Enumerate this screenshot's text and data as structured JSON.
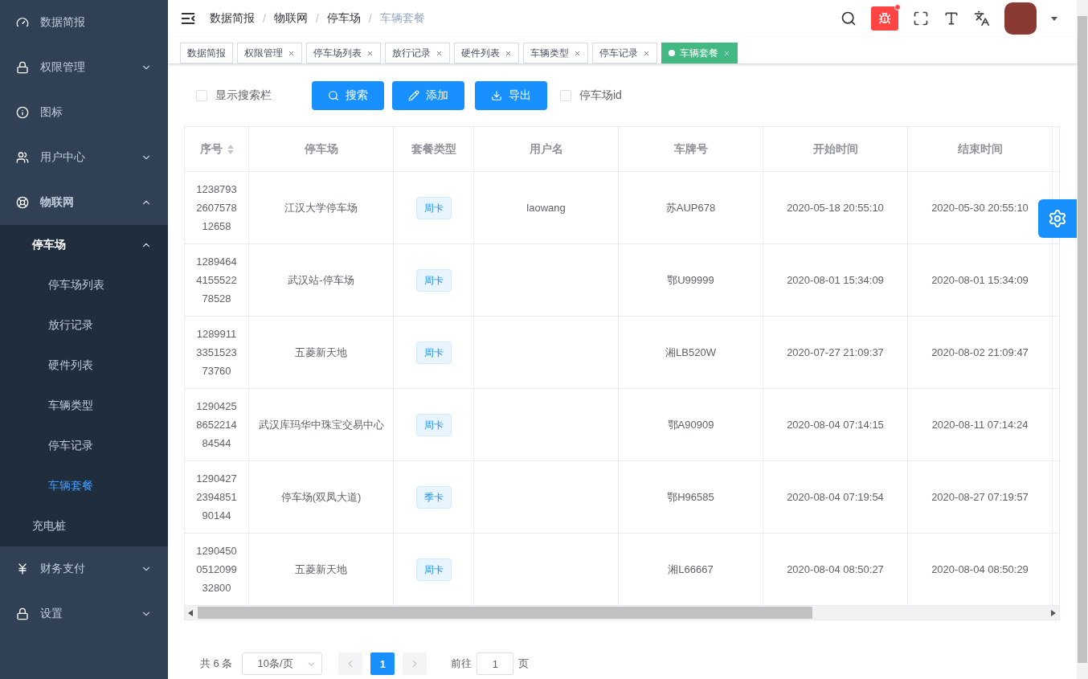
{
  "sidebar": {
    "items": [
      {
        "label": "数据简报",
        "selected": false
      },
      {
        "label": "权限管理",
        "expanded": false,
        "selected": false
      },
      {
        "label": "图标",
        "selected": false
      },
      {
        "label": "用户中心",
        "expanded": false,
        "selected": false
      },
      {
        "label": "物联网",
        "expanded": true,
        "selected": false,
        "children": [
          {
            "label": "停车场",
            "expanded": true,
            "selected": false,
            "children": [
              {
                "label": "停车场列表",
                "selected": false
              },
              {
                "label": "放行记录",
                "selected": false
              },
              {
                "label": "硬件列表",
                "selected": false
              },
              {
                "label": "车辆类型",
                "selected": false
              },
              {
                "label": "停车记录",
                "selected": false
              },
              {
                "label": "车辆套餐",
                "selected": true
              }
            ]
          },
          {
            "label": "充电桩",
            "selected": false
          }
        ]
      },
      {
        "label": "财务支付",
        "expanded": false,
        "selected": false
      },
      {
        "label": "设置",
        "expanded": false,
        "selected": false
      }
    ]
  },
  "breadcrumb": [
    "数据简报",
    "物联网",
    "停车场",
    "车辆套餐"
  ],
  "breadcrumb_separator": "/",
  "header": {
    "bug_badge": true
  },
  "tags": [
    {
      "label": "数据简报",
      "selected": false,
      "closable": false
    },
    {
      "label": "权限管理",
      "selected": false,
      "closable": true
    },
    {
      "label": "停车场列表",
      "selected": false,
      "closable": true
    },
    {
      "label": "放行记录",
      "selected": false,
      "closable": true
    },
    {
      "label": "硬件列表",
      "selected": false,
      "closable": true
    },
    {
      "label": "车辆类型",
      "selected": false,
      "closable": true
    },
    {
      "label": "停车记录",
      "selected": false,
      "closable": true
    },
    {
      "label": "车辆套餐",
      "selected": true,
      "closable": true
    }
  ],
  "toolbar": {
    "show_search": {
      "label": "显示搜索栏",
      "checked": false
    },
    "buttons": [
      "搜索",
      "添加",
      "导出"
    ],
    "column_toggle": {
      "label": "停车场id",
      "checked": false
    }
  },
  "table": {
    "columns": [
      "序号",
      "停车场",
      "套餐类型",
      "用户名",
      "车牌号",
      "开始时间",
      "结束时间"
    ],
    "rows": [
      [
        "1238793260757812658",
        "江汉大学停车场",
        "周卡",
        "laowang",
        "苏AUP678",
        "2020-05-18 20:55:10",
        "2020-05-30 20:55:10"
      ],
      [
        "1289464415552278528",
        "武汉站-停车场",
        "周卡",
        "",
        "鄂U99999",
        "2020-08-01 15:34:09",
        "2020-08-01 15:34:09"
      ],
      [
        "1289911335152373760",
        "五菱新天地",
        "周卡",
        "",
        "湘LB520W",
        "2020-07-27 21:09:37",
        "2020-08-02 21:09:47"
      ],
      [
        "1290425865221484544",
        "武汉库玛华中珠宝交易中心",
        "周卡",
        "",
        "鄂A90909",
        "2020-08-04 07:14:15",
        "2020-08-11 07:14:24"
      ],
      [
        "1290427239485190144",
        "停车场(双凤大道)",
        "季卡",
        "",
        "鄂H96585",
        "2020-08-04 07:19:54",
        "2020-08-27 07:19:57"
      ],
      [
        "1290450051209932800",
        "五菱新天地",
        "周卡",
        "",
        "湘L66667",
        "2020-08-04 08:50:27",
        "2020-08-04 08:50:29"
      ]
    ]
  },
  "pagination": {
    "total": "共 6 条",
    "page_size": "10条/页",
    "pages": [
      {
        "label": "1",
        "selected": true
      }
    ],
    "goto_label": "前往",
    "goto_value": "1",
    "goto_suffix": "页"
  }
}
